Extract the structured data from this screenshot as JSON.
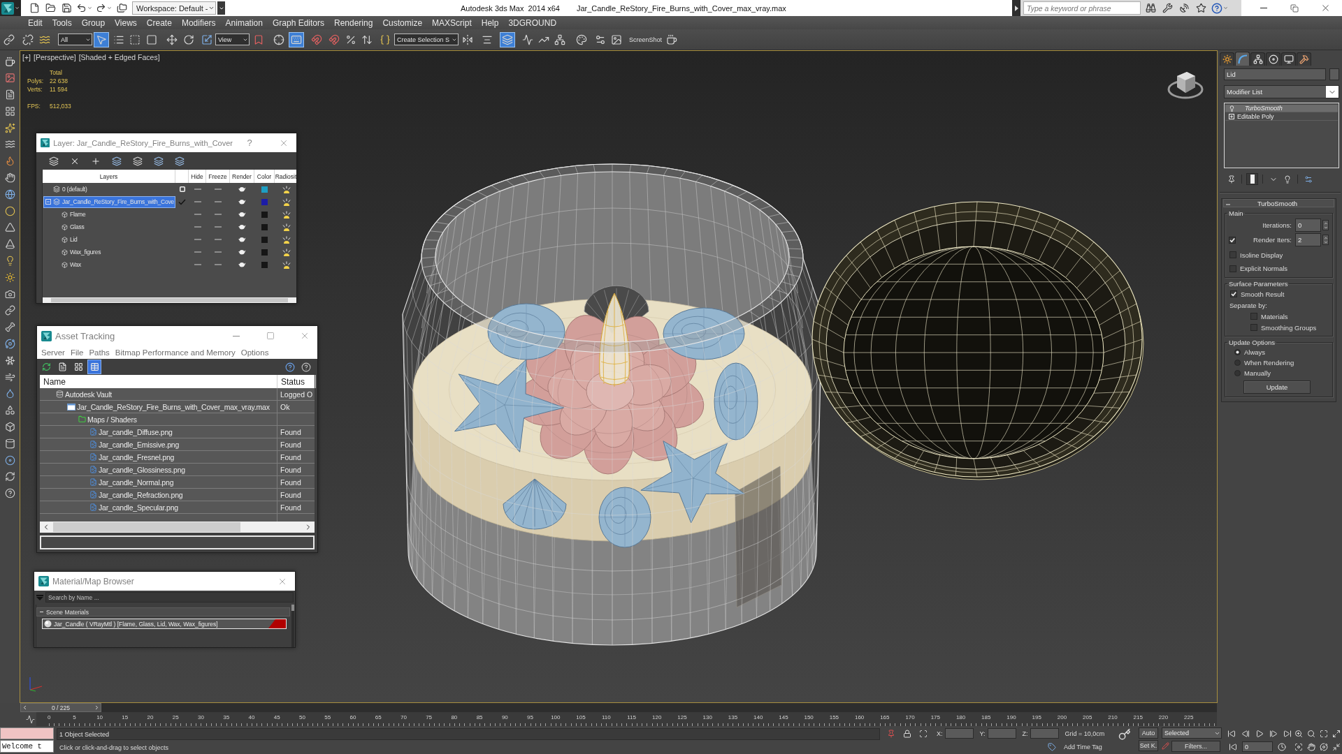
{
  "title_bar": {
    "workspace": "Workspace: Default -",
    "app_title": "Autodesk 3ds Max  2014 x64",
    "document": "Jar_Candle_ReStory_Fire_Burns_with_Cover_max_vray.max",
    "search": {
      "placeholder": "Type a keyword or phrase"
    }
  },
  "menu_bar": [
    "Edit",
    "Tools",
    "Group",
    "Views",
    "Create",
    "Modifiers",
    "Animation",
    "Graph Editors",
    "Rendering",
    "Customize",
    "MAXScript",
    "Help",
    "3DGROUND"
  ],
  "main_toolbar": {
    "selection_filter": "All",
    "reference_coordinate": "View",
    "named_selection": "Create Selection S",
    "screenshot": "ScreenShot",
    "buttons": [
      {
        "selected": false
      },
      {
        "selected": false
      },
      {
        "selected": false
      },
      {
        "selected": true
      },
      {
        "selected": false
      },
      {
        "selected": false
      },
      {
        "selected": false
      },
      {
        "selected": false
      },
      {
        "selected": false
      },
      {
        "selected": false
      },
      {
        "selected": false
      },
      {
        "selected": false
      },
      {
        "selected": true
      },
      {
        "selected": false
      },
      {
        "selected": false
      },
      {
        "selected": false
      },
      {
        "selected": false
      },
      {
        "selected": false
      },
      {
        "selected": false
      },
      {
        "selected": false
      },
      {
        "selected": true
      },
      {
        "selected": false
      },
      {
        "selected": false
      },
      {
        "selected": false
      },
      {
        "selected": false
      },
      {
        "selected": false
      },
      {
        "selected": false
      },
      {
        "selected": false
      }
    ]
  },
  "viewport": {
    "labels": [
      "[+]",
      "[Perspective]",
      "[Shaded + Edged Faces]"
    ],
    "stats": {
      "heading": "Total",
      "rows": [
        {
          "label": "Polys:",
          "value": "22 638"
        },
        {
          "label": "Verts:",
          "value": "11 594"
        }
      ],
      "fps": {
        "label": "FPS:",
        "value": "512,033"
      }
    }
  },
  "layer_dialog": {
    "title": "Layer: Jar_Candle_ReStory_Fire_Burns_with_Cover",
    "help": "?",
    "columns": [
      "Layers",
      "Hide",
      "Freeze",
      "Render",
      "Color",
      "Radiosit"
    ],
    "layers": [
      {
        "name": "0 (default)",
        "selected": false,
        "current": false,
        "hidden": false,
        "frozen": false,
        "renderable": true,
        "color": "#1e9ec2",
        "radiosity": true
      },
      {
        "name": "Jar_Candle_ReStory_Fire_Burns_with_Cove",
        "selected": true,
        "current": true,
        "expanded": true,
        "hidden": false,
        "frozen": false,
        "renderable": true,
        "color": "#1c1ca6",
        "radiosity": true,
        "children": [
          {
            "name": "Flame",
            "selected": false,
            "hidden": false,
            "frozen": false,
            "renderable": true,
            "color": "#161616",
            "radiosity": true
          },
          {
            "name": "Glass",
            "selected": false,
            "hidden": false,
            "frozen": false,
            "renderable": true,
            "color": "#161616",
            "radiosity": true
          },
          {
            "name": "Lid",
            "selected": false,
            "hidden": false,
            "frozen": false,
            "renderable": true,
            "color": "#161616",
            "radiosity": true
          },
          {
            "name": "Wax_figures",
            "selected": false,
            "hidden": false,
            "frozen": false,
            "renderable": true,
            "color": "#161616",
            "radiosity": true
          },
          {
            "name": "Wax",
            "selected": false,
            "hidden": false,
            "frozen": false,
            "renderable": true,
            "color": "#161616",
            "radiosity": true
          }
        ]
      }
    ]
  },
  "asset_tracking": {
    "title": "Asset Tracking",
    "menu": [
      "Server",
      "File",
      "Paths",
      "Bitmap Performance and Memory",
      "Options"
    ],
    "toolbar": [
      {
        "selected": false
      },
      {
        "selected": false
      },
      {
        "selected": false
      },
      {
        "selected": true
      }
    ],
    "columns": [
      "Name",
      "Status"
    ],
    "assets": [
      {
        "kind": "vault",
        "name": "Autodesk Vault",
        "status": "Logged O",
        "children": [
          {
            "kind": "scene",
            "name": "Jar_Candle_ReStory_Fire_Burns_with_Cover_max_vray.max",
            "status": "Ok",
            "children": [
              {
                "kind": "folder",
                "name": "Maps / Shaders",
                "children": [
                  {
                    "kind": "bitmap",
                    "name": "Jar_candle_Diffuse.png",
                    "status": "Found"
                  },
                  {
                    "kind": "bitmap",
                    "name": "Jar_candle_Emissive.png",
                    "status": "Found"
                  },
                  {
                    "kind": "bitmap",
                    "name": "Jar_candle_Fresnel.png",
                    "status": "Found"
                  },
                  {
                    "kind": "bitmap",
                    "name": "Jar_candle_Glossiness.png",
                    "status": "Found"
                  },
                  {
                    "kind": "bitmap",
                    "name": "Jar_candle_Normal.png",
                    "status": "Found"
                  },
                  {
                    "kind": "bitmap",
                    "name": "Jar_candle_Refraction.png",
                    "status": "Found"
                  },
                  {
                    "kind": "bitmap",
                    "name": "Jar_candle_Specular.png",
                    "status": "Found"
                  }
                ]
              }
            ]
          }
        ]
      }
    ]
  },
  "material_browser": {
    "title": "Material/Map Browser",
    "search": {
      "placeholder": "Search by Name ..."
    },
    "groups": [
      {
        "title": "Scene Materials",
        "expanded": true,
        "materials": [
          {
            "label": "Jar_Candle ( VRayMtl ) [Flame, Glass, Lid, Wax, Wax_figures]",
            "selected": true
          }
        ]
      }
    ]
  },
  "command_panel": {
    "tabs": [
      {
        "selected": false
      },
      {
        "selected": true
      },
      {
        "selected": false
      },
      {
        "selected": false
      },
      {
        "selected": false
      },
      {
        "selected": false
      }
    ],
    "object_name": "Lid",
    "modifier_list": "Modifier List",
    "stack": [
      {
        "kind": "modifier",
        "name": "TurboSmooth",
        "selected": true
      },
      {
        "kind": "base",
        "name": "Editable Poly",
        "selected": false,
        "expanded": false
      }
    ],
    "stack_buttons": [
      {
        "selected": false
      },
      {
        "selected": true
      },
      {
        "selected": false
      },
      {
        "selected": false
      },
      {
        "selected": false
      }
    ],
    "rollout": {
      "title": "TurboSmooth",
      "expanded": true,
      "main": {
        "title": "Main",
        "iterations": {
          "label": "Iterations:",
          "value": "0"
        },
        "render_iters": {
          "label": "Render Iters:",
          "value": "2",
          "checked": true
        },
        "options": [
          {
            "label": "Isoline Display",
            "checked": false
          },
          {
            "label": "Explicit Normals",
            "checked": false
          }
        ]
      },
      "surface": {
        "title": "Surface Parameters",
        "smooth_result": {
          "label": "Smooth Result",
          "checked": true
        },
        "separate_by": "Separate by:",
        "separators": [
          {
            "label": "Materials",
            "checked": false
          },
          {
            "label": "Smoothing Groups",
            "checked": false
          }
        ]
      },
      "update": {
        "title": "Update Options",
        "modes": [
          {
            "label": "Always",
            "selected": true
          },
          {
            "label": "When Rendering",
            "selected": false
          },
          {
            "label": "Manually",
            "selected": false
          }
        ],
        "button": "Update"
      }
    }
  },
  "time_slider": {
    "label": "0 / 225",
    "level": 0
  },
  "track_bar": {
    "ticks": [
      "0",
      "5",
      "10",
      "15",
      "20",
      "25",
      "30",
      "35",
      "40",
      "45",
      "50",
      "55",
      "60",
      "65",
      "70",
      "75",
      "80",
      "85",
      "90",
      "95",
      "100",
      "105",
      "110",
      "115",
      "120",
      "125",
      "130",
      "135",
      "140",
      "145",
      "150",
      "155",
      "160",
      "165",
      "170",
      "175",
      "180",
      "185",
      "190",
      "195",
      "200",
      "205",
      "210",
      "215",
      "220",
      "225"
    ]
  },
  "status_bar": {
    "listener": "Welcome t",
    "selection": "1 Object Selected",
    "prompt": "Click or click-and-drag to select objects",
    "coordinates": [
      {
        "label": "X:"
      },
      {
        "label": "Y:"
      },
      {
        "label": "Z:"
      }
    ],
    "grid": "Grid = 10,0cm",
    "time_tag": "Add Time Tag",
    "auto_key": "Auto",
    "key_filter": "Selected",
    "set_key": "Set K.",
    "filters": "Filters...",
    "frame": "0"
  }
}
